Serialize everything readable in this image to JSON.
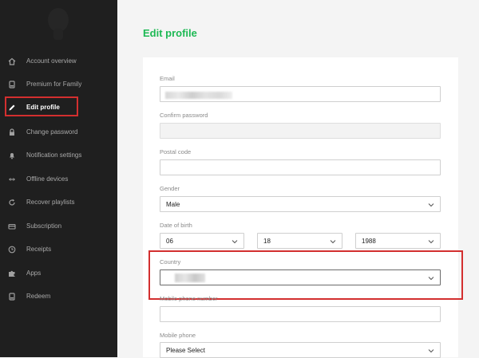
{
  "sidebar": {
    "items": [
      {
        "label": "Account overview",
        "icon": "home-icon"
      },
      {
        "label": "Premium for Family",
        "icon": "device-icon"
      },
      {
        "label": "Edit profile",
        "icon": "pencil-icon",
        "active": true
      },
      {
        "label": "Change password",
        "icon": "lock-icon"
      },
      {
        "label": "Notification settings",
        "icon": "bell-icon"
      },
      {
        "label": "Offline devices",
        "icon": "arrows-icon"
      },
      {
        "label": "Recover playlists",
        "icon": "refresh-icon"
      },
      {
        "label": "Subscription",
        "icon": "card-icon"
      },
      {
        "label": "Receipts",
        "icon": "clock-icon"
      },
      {
        "label": "Apps",
        "icon": "puzzle-icon"
      },
      {
        "label": "Redeem",
        "icon": "device-icon"
      }
    ]
  },
  "main": {
    "title": "Edit profile",
    "email": {
      "label": "Email",
      "value": ""
    },
    "confirm_password": {
      "label": "Confirm password",
      "value": ""
    },
    "postal_code": {
      "label": "Postal code",
      "value": ""
    },
    "gender": {
      "label": "Gender",
      "value": "Male"
    },
    "date_of_birth": {
      "label": "Date of birth",
      "day": "06",
      "month": "18",
      "year": "1988"
    },
    "country": {
      "label": "Country",
      "value": ""
    },
    "mobile_phone_number": {
      "label": "Mobile phone number",
      "value": ""
    },
    "mobile_phone": {
      "label": "Mobile phone",
      "value": "Please Select"
    }
  },
  "colors": {
    "accent": "#1db954",
    "highlight": "#d32f2f",
    "sidebar_bg": "#1f1f1f"
  }
}
